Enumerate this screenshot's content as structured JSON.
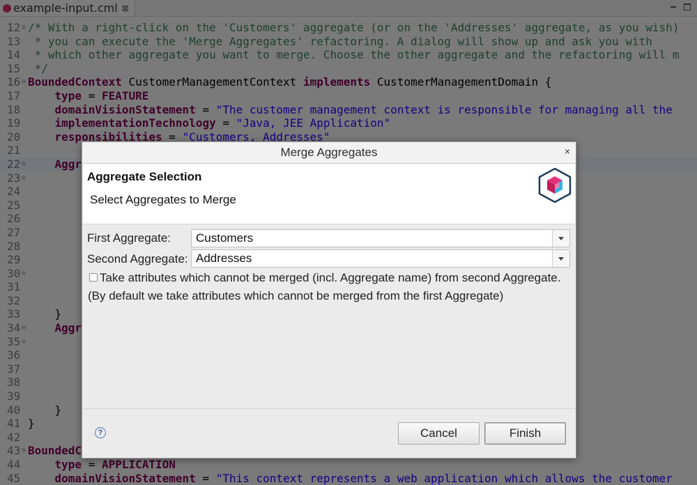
{
  "editor": {
    "tab_label": "example-input.cml",
    "tab_close": "⊠",
    "lines": [
      {
        "n": "12",
        "fold": "⊖",
        "parts": [
          {
            "c": "cm",
            "t": "/* With a right-click on the 'Customers' aggregate (or on the 'Addresses' aggregate, as you wish)"
          }
        ]
      },
      {
        "n": "13",
        "fold": "",
        "parts": [
          {
            "c": "cm",
            "t": " * you can execute the 'Merge Aggregates' refactoring. A dialog will show up and ask you with"
          }
        ]
      },
      {
        "n": "14",
        "fold": "",
        "parts": [
          {
            "c": "cm",
            "t": " * which other aggregate you want to merge. Choose the other aggregate and the refactoring will m"
          }
        ]
      },
      {
        "n": "15",
        "fold": "",
        "parts": [
          {
            "c": "cm",
            "t": " */"
          }
        ]
      },
      {
        "n": "16",
        "fold": "⊖",
        "parts": [
          {
            "c": "kw",
            "t": "BoundedContext"
          },
          {
            "c": "",
            "t": " CustomerManagementContext "
          },
          {
            "c": "kw",
            "t": "implements"
          },
          {
            "c": "",
            "t": " CustomerManagementDomain {"
          }
        ]
      },
      {
        "n": "17",
        "fold": "",
        "parts": [
          {
            "c": "",
            "t": "    "
          },
          {
            "c": "kw",
            "t": "type"
          },
          {
            "c": "",
            "t": " = "
          },
          {
            "c": "kw",
            "t": "FEATURE"
          }
        ]
      },
      {
        "n": "18",
        "fold": "",
        "parts": [
          {
            "c": "",
            "t": "    "
          },
          {
            "c": "kw",
            "t": "domainVisionStatement"
          },
          {
            "c": "",
            "t": " = "
          },
          {
            "c": "st",
            "t": "\"The customer management context is responsible for managing all the"
          }
        ]
      },
      {
        "n": "19",
        "fold": "",
        "parts": [
          {
            "c": "",
            "t": "    "
          },
          {
            "c": "kw",
            "t": "implementationTechnology"
          },
          {
            "c": "",
            "t": " = "
          },
          {
            "c": "st",
            "t": "\"Java, JEE Application\""
          }
        ]
      },
      {
        "n": "20",
        "fold": "",
        "parts": [
          {
            "c": "",
            "t": "    "
          },
          {
            "c": "kw",
            "t": "responsibilities"
          },
          {
            "c": "",
            "t": " = "
          },
          {
            "c": "st",
            "t": "\"Customers, Addresses\""
          }
        ]
      },
      {
        "n": "21",
        "fold": "",
        "parts": []
      },
      {
        "n": "22",
        "fold": "⊖",
        "hl": true,
        "parts": [
          {
            "c": "",
            "t": "    "
          },
          {
            "c": "kw",
            "t": "Aggr"
          }
        ]
      },
      {
        "n": "23",
        "fold": "⊖",
        "parts": []
      },
      {
        "n": "24",
        "fold": "",
        "parts": []
      },
      {
        "n": "25",
        "fold": "",
        "parts": []
      },
      {
        "n": "26",
        "fold": "",
        "parts": []
      },
      {
        "n": "27",
        "fold": "",
        "parts": []
      },
      {
        "n": "28",
        "fold": "",
        "parts": []
      },
      {
        "n": "29",
        "fold": "",
        "parts": []
      },
      {
        "n": "30",
        "fold": "⊖",
        "parts": []
      },
      {
        "n": "31",
        "fold": "",
        "parts": []
      },
      {
        "n": "32",
        "fold": "",
        "parts": []
      },
      {
        "n": "33",
        "fold": "",
        "parts": [
          {
            "c": "",
            "t": "    }"
          }
        ]
      },
      {
        "n": "34",
        "fold": "⊖",
        "parts": [
          {
            "c": "",
            "t": "    "
          },
          {
            "c": "kw",
            "t": "Aggr"
          }
        ]
      },
      {
        "n": "35",
        "fold": "⊖",
        "parts": []
      },
      {
        "n": "36",
        "fold": "",
        "parts": []
      },
      {
        "n": "37",
        "fold": "",
        "parts": []
      },
      {
        "n": "38",
        "fold": "",
        "parts": []
      },
      {
        "n": "39",
        "fold": "",
        "parts": []
      },
      {
        "n": "40",
        "fold": "",
        "parts": [
          {
            "c": "",
            "t": "    }"
          }
        ]
      },
      {
        "n": "41",
        "fold": "",
        "parts": [
          {
            "c": "",
            "t": "}"
          }
        ]
      },
      {
        "n": "42",
        "fold": "",
        "parts": []
      },
      {
        "n": "43",
        "fold": "⊖",
        "parts": [
          {
            "c": "kw",
            "t": "BoundedC"
          }
        ]
      },
      {
        "n": "44",
        "fold": "",
        "parts": [
          {
            "c": "",
            "t": "    "
          },
          {
            "c": "kw",
            "t": "type"
          },
          {
            "c": "",
            "t": " = "
          },
          {
            "c": "kw",
            "t": "APPLICATION"
          }
        ]
      },
      {
        "n": "45",
        "fold": "",
        "parts": [
          {
            "c": "",
            "t": "    "
          },
          {
            "c": "kw",
            "t": "domainVisionStatement"
          },
          {
            "c": "",
            "t": " = "
          },
          {
            "c": "st",
            "t": "\"This context represents a web application which allows the customer"
          }
        ]
      }
    ]
  },
  "dialog": {
    "title": "Merge Aggregates",
    "close_glyph": "×",
    "header_title": "Aggregate Selection",
    "header_message": "Select Aggregates to Merge",
    "first_label": "First Aggregate:",
    "first_value": "Customers",
    "second_label": "Second Aggregate:",
    "second_value": "Addresses",
    "checkbox_label": "Take attributes which cannot be merged (incl. Aggregate name) from second Aggregate.",
    "checkbox_checked": false,
    "note": "(By default we take attributes which cannot be merged from the first Aggregate)",
    "help_glyph": "?",
    "cancel_label": "Cancel",
    "finish_label": "Finish",
    "logo_colors": {
      "outline": "#1f3b57",
      "top": "#e5317a",
      "right": "#2fb6e6",
      "left": "#c41c5a"
    }
  }
}
